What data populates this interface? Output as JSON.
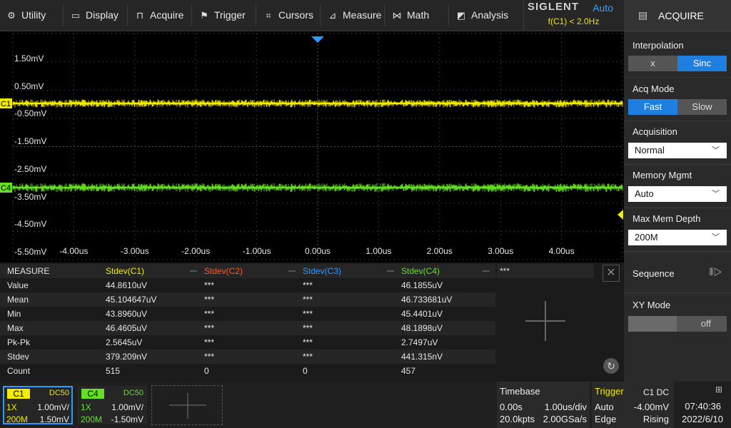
{
  "menu": {
    "utility": "Utility",
    "display": "Display",
    "acquire": "Acquire",
    "trigger": "Trigger",
    "cursors": "Cursors",
    "measure": "Measure",
    "math": "Math",
    "analysis": "Analysis"
  },
  "brand": {
    "name": "SIGLENT",
    "trigger_mode": "Auto",
    "frequency": "f(C1) < 2.0Hz"
  },
  "screen": {
    "y_labels": [
      "1.50mV",
      "0.50mV",
      "-0.50mV",
      "-1.50mV",
      "-2.50mV",
      "-3.50mV",
      "-4.50mV",
      "-5.50mV"
    ],
    "x_labels": [
      "-4.00us",
      "-3.00us",
      "-2.00us",
      "-1.00us",
      "0.00us",
      "1.00us",
      "2.00us",
      "3.00us",
      "4.00us"
    ],
    "markers": {
      "c1": "C1",
      "c4": "C4"
    }
  },
  "colors": {
    "c1": "#f2ec00",
    "c2": "#ff5a1e",
    "c3": "#2b9bff",
    "c4": "#66e022",
    "accent": "#1f7fe0"
  },
  "panel": {
    "title": "ACQUIRE",
    "interpolation": {
      "label": "Interpolation",
      "opt_x": "x",
      "opt_sinc": "Sinc"
    },
    "acq_mode": {
      "label": "Acq Mode",
      "opt_fast": "Fast",
      "opt_slow": "Slow"
    },
    "acquisition": {
      "label": "Acquisition",
      "value": "Normal"
    },
    "memory_mgmt": {
      "label": "Memory Mgmt",
      "value": "Auto"
    },
    "max_mem_depth": {
      "label": "Max Mem Depth",
      "value": "200M"
    },
    "sequence": {
      "label": "Sequence"
    },
    "xy_mode": {
      "label": "XY Mode",
      "value": "off"
    }
  },
  "measure": {
    "header": [
      "MEASURE",
      "Stdev(C1)",
      "Stdev(C2)",
      "Stdev(C3)",
      "Stdev(C4)"
    ],
    "extra": "***",
    "rows": [
      [
        "Value",
        "44.8610uV",
        "***",
        "***",
        "46.1855uV"
      ],
      [
        "Mean",
        "45.104647uV",
        "***",
        "***",
        "46.733681uV"
      ],
      [
        "Min",
        "43.8960uV",
        "***",
        "***",
        "45.4401uV"
      ],
      [
        "Max",
        "46.4605uV",
        "***",
        "***",
        "48.1898uV"
      ],
      [
        "Pk-Pk",
        "2.5645uV",
        "***",
        "***",
        "2.7497uV"
      ],
      [
        "Stdev",
        "379.209nV",
        "***",
        "***",
        "441.315nV"
      ],
      [
        "Count",
        "515",
        "0",
        "0",
        "457"
      ]
    ]
  },
  "channels": {
    "c1": {
      "name": "C1",
      "coupling": "DC50",
      "probe": "1X",
      "scale": "1.00mV/",
      "bw": "200M",
      "offset": "1.50mV"
    },
    "c4": {
      "name": "C4",
      "coupling": "DC50",
      "probe": "1X",
      "scale": "1.00mV/",
      "bw": "200M",
      "offset": "-1.50mV"
    }
  },
  "timebase": {
    "title": "Timebase",
    "delay": "0.00s",
    "scale": "1.00us/div",
    "points": "20.0kpts",
    "rate": "2.00GSa/s"
  },
  "trigger": {
    "title": "Trigger",
    "source": "C1 DC",
    "mode": "Auto",
    "level": "-4.00mV",
    "type": "Edge",
    "slope": "Rising"
  },
  "clock": {
    "time": "07:40:36",
    "date": "2022/6/10"
  }
}
